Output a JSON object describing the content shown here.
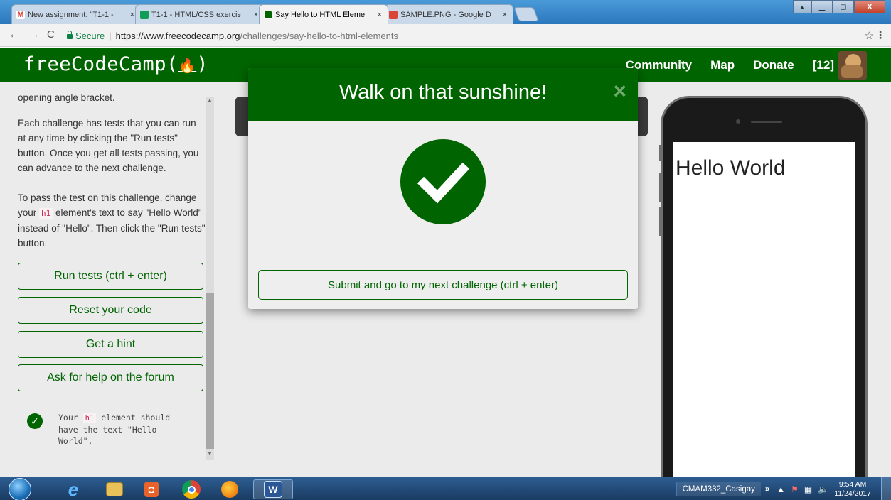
{
  "browser": {
    "tabs": [
      {
        "title": "New assignment: \"T1-1 -",
        "icon_color": "#d93025",
        "icon": "gmail-icon"
      },
      {
        "title": "T1-1 - HTML/CSS exercis",
        "icon_color": "#0f9d58",
        "icon": "classroom-icon"
      },
      {
        "title": "Say Hello to HTML Eleme",
        "icon_color": "#006400",
        "icon": "freecodecamp-icon"
      },
      {
        "title": "SAMPLE.PNG - Google D",
        "icon_color": "#db4437",
        "icon": "google-drive-image-icon"
      }
    ],
    "close_glyph": "×",
    "window_buttons": {
      "minimize": "▁",
      "maximize": "◻",
      "close": "X"
    },
    "address": {
      "secure_label": "Secure",
      "separator": "|",
      "url_host": "https://www.freecodecamp.org",
      "url_path": "/challenges/say-hello-to-html-elements"
    }
  },
  "navbar": {
    "logo_text_pre": "freeCodeCamp(",
    "logo_flame": "🔥",
    "logo_text_post": ")",
    "links": [
      "Community",
      "Map",
      "Donate",
      "[12]"
    ],
    "bg": "#006400"
  },
  "sidebar": {
    "para_top": "opening angle bracket.",
    "para1": "Each challenge has tests that you can run at any time by clicking the \"Run tests\" button. Once you get all tests passing, you can advance to the next challenge.",
    "para2_a": "To pass the test on this challenge, change your",
    "para2_code": "h1",
    "para2_b": "element's text to say \"Hello World\" instead of \"Hello\". Then click the \"Run tests\" button.",
    "buttons": {
      "run": "Run tests (ctrl + enter)",
      "reset": "Reset your code",
      "hint": "Get a hint",
      "forum": "Ask for help on the forum"
    },
    "test": {
      "pre": "Your",
      "code": "h1",
      "post": "element should have the text \"Hello World\"."
    }
  },
  "preview": {
    "heading": "Hello World"
  },
  "modal": {
    "title": "Walk on that sunshine!",
    "close": "×",
    "submit": "Submit and go to my next challenge (ctrl + enter)"
  },
  "taskbar": {
    "user": "CMAM332_Casigay",
    "chevron": "»",
    "time": "9:54 AM",
    "date": "11/24/2017"
  }
}
